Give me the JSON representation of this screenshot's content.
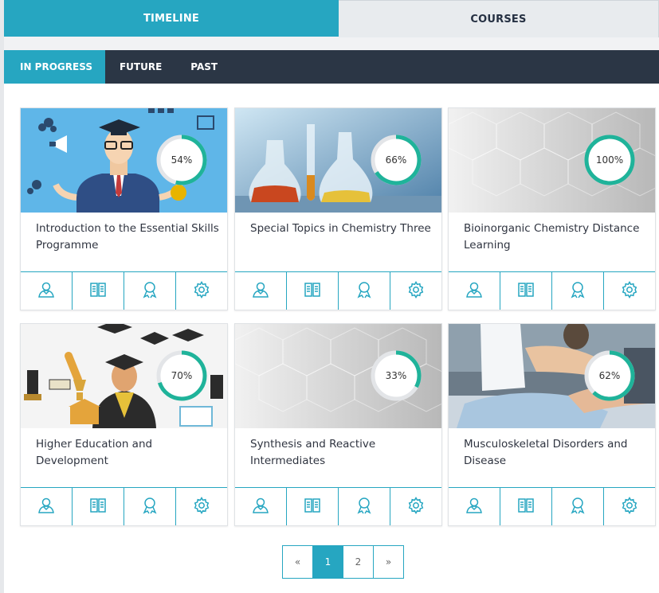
{
  "tabs": {
    "timeline": "TIMELINE",
    "courses": "COURSES"
  },
  "subtabs": [
    "IN PROGRESS",
    "FUTURE",
    "PAST"
  ],
  "courses": [
    {
      "title": "Introduction to the Essential Skills Programme",
      "progress": 54,
      "progress_label": "54%",
      "image": "graduate-illustration"
    },
    {
      "title": "Special Topics in Chemistry Three",
      "progress": 66,
      "progress_label": "66%",
      "image": "chemistry-flasks"
    },
    {
      "title": "Bioinorganic Chemistry Distance Learning",
      "progress": 100,
      "progress_label": "100%",
      "image": "grey-hexagon-pattern"
    },
    {
      "title": "Higher Education and Development",
      "progress": 70,
      "progress_label": "70%",
      "image": "graduation-illustration"
    },
    {
      "title": "Synthesis and Reactive Intermediates",
      "progress": 33,
      "progress_label": "33%",
      "image": "grey-hexagon-pattern"
    },
    {
      "title": "Musculoskeletal Disorders and Disease",
      "progress": 62,
      "progress_label": "62%",
      "image": "physiotherapy-photo"
    }
  ],
  "card_actions": [
    "participants-icon",
    "book-icon",
    "badge-icon",
    "settings-icon"
  ],
  "pagination": {
    "prev": "«",
    "pages": [
      "1",
      "2"
    ],
    "next": "»",
    "current": "1"
  },
  "colors": {
    "accent": "#26a6c1",
    "dark_nav": "#2b3645",
    "ring": "#1fb39a"
  }
}
